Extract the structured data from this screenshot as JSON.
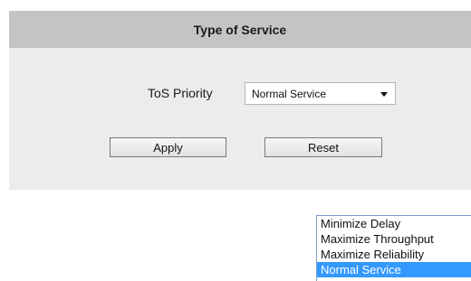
{
  "panel": {
    "title": "Type of Service"
  },
  "tos": {
    "label": "ToS Priority",
    "selected_value": "Normal Service",
    "options": [
      "Minimize Delay",
      "Maximize Throughput",
      "Maximize Reliability",
      "Normal Service"
    ],
    "selected_index": 3
  },
  "buttons": {
    "apply_label": "Apply",
    "reset_label": "Reset"
  },
  "colors": {
    "header_bg": "#c4c4c4",
    "panel_bg": "#ececec",
    "selection_bg": "#3399ff"
  },
  "icons": {
    "dropdown": "chevron-down-icon"
  }
}
